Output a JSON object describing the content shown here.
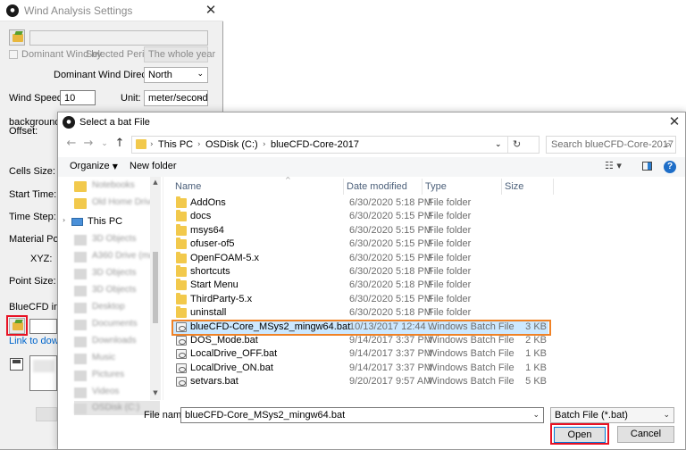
{
  "bg_window": {
    "title": "Wind Analysis Settings",
    "dominant_wind_by": "Dominant Wind by",
    "selected_period": "Selected Period",
    "period_value": "The whole year",
    "dominant_wind_direction_label": "Dominant Wind Direction:",
    "dominant_wind_direction_value": "North",
    "wind_speed_label": "Wind Speed:",
    "wind_speed_value": "10",
    "unit_label": "Unit:",
    "unit_value": "meter/second",
    "background_label_1": "backgroundMe",
    "background_label_2": "Offset:",
    "cells_size_label": "Cells Size:",
    "start_time_label": "Start Time:",
    "time_step_label": "Time Step:",
    "material_point_label": "Material Point",
    "xyz_label": "XYZ:",
    "point_size_label": "Point Size:",
    "bluecfd_label": "BlueCFD insta",
    "link_label": "Link to downlo"
  },
  "dialog": {
    "title": "Select a bat File",
    "breadcrumbs": [
      "This PC",
      "OSDisk (C:)",
      "blueCFD-Core-2017"
    ],
    "search_placeholder": "Search blueCFD-Core-2017",
    "organize_label": "Organize",
    "new_folder_label": "New folder",
    "nav_items": [
      {
        "label": "Notebooks"
      },
      {
        "label": "Old Home Drive"
      },
      {
        "label": "This PC"
      },
      {
        "label": "3D Objects"
      },
      {
        "label": "A360 Drive (ma)"
      },
      {
        "label": "3D Objects"
      },
      {
        "label": "3D Objects"
      },
      {
        "label": "Desktop"
      },
      {
        "label": "Documents"
      },
      {
        "label": "Downloads"
      },
      {
        "label": "Music"
      },
      {
        "label": "Pictures"
      },
      {
        "label": "Videos"
      },
      {
        "label": "OSDisk (C:)"
      }
    ],
    "columns": {
      "name": "Name",
      "date": "Date modified",
      "type": "Type",
      "size": "Size"
    },
    "files": [
      {
        "name": "AddOns",
        "date": "6/30/2020 5:18 PM",
        "type": "File folder",
        "size": "",
        "kind": "folder"
      },
      {
        "name": "docs",
        "date": "6/30/2020 5:15 PM",
        "type": "File folder",
        "size": "",
        "kind": "folder"
      },
      {
        "name": "msys64",
        "date": "6/30/2020 5:15 PM",
        "type": "File folder",
        "size": "",
        "kind": "folder"
      },
      {
        "name": "ofuser-of5",
        "date": "6/30/2020 5:15 PM",
        "type": "File folder",
        "size": "",
        "kind": "folder"
      },
      {
        "name": "OpenFOAM-5.x",
        "date": "6/30/2020 5:15 PM",
        "type": "File folder",
        "size": "",
        "kind": "folder"
      },
      {
        "name": "shortcuts",
        "date": "6/30/2020 5:18 PM",
        "type": "File folder",
        "size": "",
        "kind": "folder"
      },
      {
        "name": "Start Menu",
        "date": "6/30/2020 5:18 PM",
        "type": "File folder",
        "size": "",
        "kind": "folder"
      },
      {
        "name": "ThirdParty-5.x",
        "date": "6/30/2020 5:15 PM",
        "type": "File folder",
        "size": "",
        "kind": "folder"
      },
      {
        "name": "uninstall",
        "date": "6/30/2020 5:18 PM",
        "type": "File folder",
        "size": "",
        "kind": "folder"
      },
      {
        "name": "blueCFD-Core_MSys2_mingw64.bat",
        "date": "10/13/2017 12:44 ...",
        "type": "Windows Batch File",
        "size": "3 KB",
        "kind": "bat",
        "selected": true
      },
      {
        "name": "DOS_Mode.bat",
        "date": "9/14/2017 3:37 PM",
        "type": "Windows Batch File",
        "size": "2 KB",
        "kind": "bat"
      },
      {
        "name": "LocalDrive_OFF.bat",
        "date": "9/14/2017 3:37 PM",
        "type": "Windows Batch File",
        "size": "1 KB",
        "kind": "bat"
      },
      {
        "name": "LocalDrive_ON.bat",
        "date": "9/14/2017 3:37 PM",
        "type": "Windows Batch File",
        "size": "1 KB",
        "kind": "bat"
      },
      {
        "name": "setvars.bat",
        "date": "9/20/2017 9:57 AM",
        "type": "Windows Batch File",
        "size": "5 KB",
        "kind": "bat"
      }
    ],
    "filename_label": "File name:",
    "filename_value": "blueCFD-Core_MSys2_mingw64.bat",
    "filetype_value": "Batch File (*.bat)",
    "open_label": "Open",
    "cancel_label": "Cancel"
  },
  "colors": {
    "highlight_red": "#e81224",
    "highlight_orange": "#f08226",
    "selection": "#cce8ff",
    "folder": "#f2c94c"
  }
}
